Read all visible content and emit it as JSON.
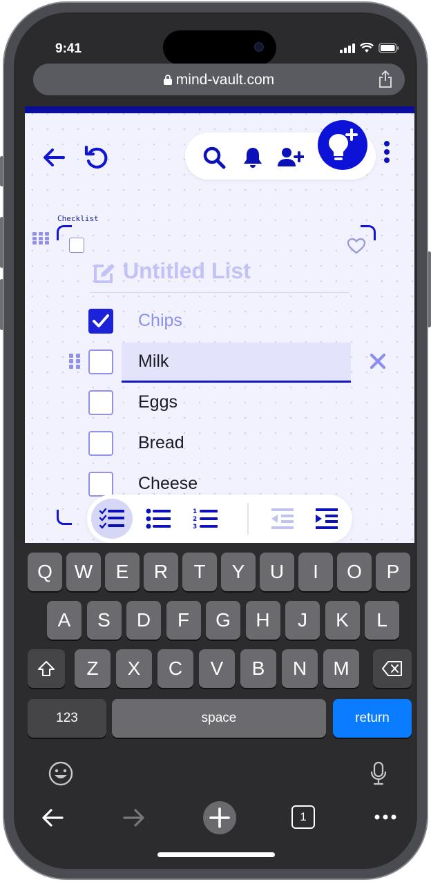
{
  "status_bar": {
    "time": "9:41"
  },
  "browser": {
    "url": "mind-vault.com"
  },
  "toolbar_top": {
    "back_label": "back",
    "refresh_label": "refresh"
  },
  "card": {
    "type_label": "Checklist",
    "title_placeholder": "Untitled List",
    "items": [
      {
        "text": "Chips",
        "checked": true
      },
      {
        "text": "Milk",
        "checked": false
      },
      {
        "text": "Eggs",
        "checked": false
      },
      {
        "text": "Bread",
        "checked": false
      },
      {
        "text": "Cheese",
        "checked": false
      }
    ]
  },
  "keyboard": {
    "row1": [
      "Q",
      "W",
      "E",
      "R",
      "T",
      "Y",
      "U",
      "I",
      "O",
      "P"
    ],
    "row2": [
      "A",
      "S",
      "D",
      "F",
      "G",
      "H",
      "J",
      "K",
      "L"
    ],
    "row3": [
      "Z",
      "X",
      "C",
      "V",
      "B",
      "N",
      "M"
    ],
    "numbers_label": "123",
    "space_label": "space",
    "return_label": "return"
  },
  "browser_toolbar": {
    "tab_count": "1"
  },
  "colors": {
    "accent": "#0c12d6",
    "accent_soft": "#9191ea",
    "page_bg": "#f2f2fe",
    "return_key": "#0a7cff"
  },
  "icons": [
    "back-arrow-icon",
    "refresh-icon",
    "search-icon",
    "bell-icon",
    "add-user-icon",
    "lightbulb-plus-icon",
    "more-vertical-icon",
    "grid-handle-icon",
    "heart-icon",
    "edit-icon",
    "checklist-icon",
    "bullet-list-icon",
    "numbered-list-icon",
    "outdent-icon",
    "indent-icon",
    "close-icon",
    "shift-icon",
    "backspace-icon",
    "emoji-icon",
    "microphone-icon",
    "plus-icon",
    "tabs-icon",
    "more-horizontal-icon"
  ]
}
